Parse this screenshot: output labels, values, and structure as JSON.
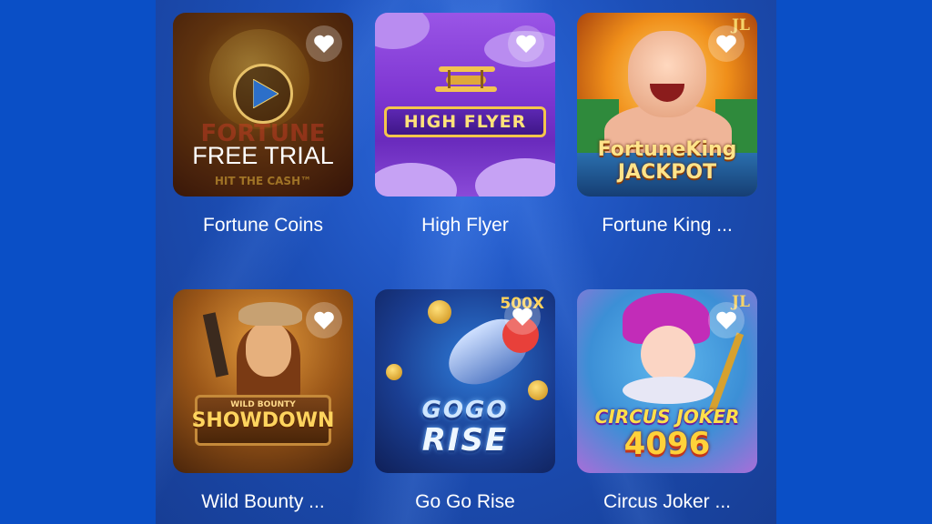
{
  "games": [
    {
      "title": "Fortune Coins",
      "overlay": "FREE TRIAL",
      "art_text": "FORTUNE",
      "art_subtext": "HIT THE CASH™"
    },
    {
      "title": "High Flyer",
      "art_text": "HIGH FLYER"
    },
    {
      "title": "Fortune King ...",
      "art_text_1": "FortuneKing",
      "art_text_2": "JACKPOT",
      "badge": "JL"
    },
    {
      "title": "Wild Bounty ...",
      "art_text_small": "WILD BOUNTY",
      "art_text": "SHOWDOWN"
    },
    {
      "title": "Go Go Rise",
      "art_text_1": "GOGO",
      "art_text_2": "RISE",
      "badge": "500X"
    },
    {
      "title": "Circus Joker ...",
      "art_text_1": "CIRCUS JOKER",
      "art_text_2": "4096",
      "badge": "JL"
    }
  ],
  "icons": {
    "favorite": "heart-icon",
    "play": "play-icon"
  },
  "colors": {
    "page_background": "#0a4fc6",
    "panel_background": "#1c4fb8",
    "text": "#ffffff"
  }
}
